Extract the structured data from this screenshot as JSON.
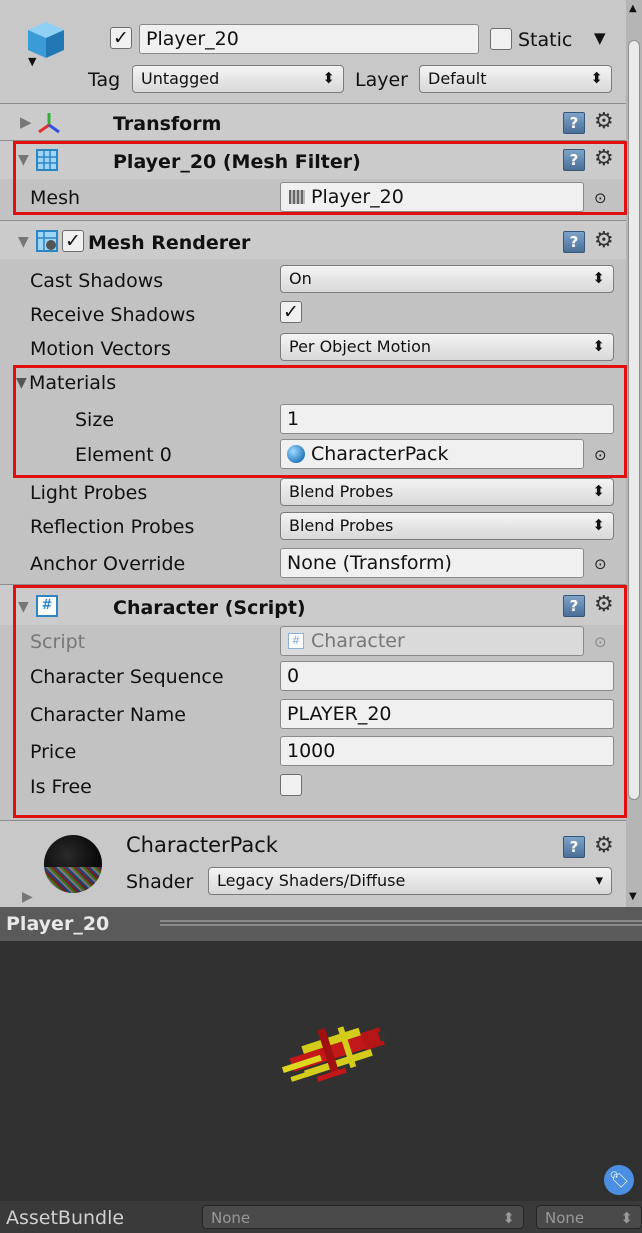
{
  "header": {
    "name": "Player_20",
    "static_label": "Static",
    "tag_label": "Tag",
    "tag_value": "Untagged",
    "layer_label": "Layer",
    "layer_value": "Default"
  },
  "transform": {
    "title": "Transform"
  },
  "mesh_filter": {
    "title": "Player_20 (Mesh Filter)",
    "mesh_label": "Mesh",
    "mesh_value": "Player_20"
  },
  "mesh_renderer": {
    "title": "Mesh Renderer",
    "cast_shadows_label": "Cast Shadows",
    "cast_shadows_value": "On",
    "receive_shadows_label": "Receive Shadows",
    "motion_vectors_label": "Motion Vectors",
    "motion_vectors_value": "Per Object Motion",
    "materials_label": "Materials",
    "size_label": "Size",
    "size_value": "1",
    "element0_label": "Element 0",
    "element0_value": "CharacterPack",
    "light_probes_label": "Light Probes",
    "light_probes_value": "Blend Probes",
    "reflection_probes_label": "Reflection Probes",
    "reflection_probes_value": "Blend Probes",
    "anchor_override_label": "Anchor Override",
    "anchor_override_value": "None (Transform)"
  },
  "character_script": {
    "title": "Character (Script)",
    "script_label": "Script",
    "script_value": "Character",
    "sequence_label": "Character Sequence",
    "sequence_value": "0",
    "name_label": "Character Name",
    "name_value": "PLAYER_20",
    "price_label": "Price",
    "price_value": "1000",
    "is_free_label": "Is Free"
  },
  "material": {
    "name": "CharacterPack",
    "shader_label": "Shader",
    "shader_value": "Legacy Shaders/Diffuse"
  },
  "preview": {
    "title": "Player_20"
  },
  "assetbundle": {
    "label": "AssetBundle",
    "name_value": "None",
    "variant_value": "None"
  },
  "colors": {
    "highlight_box": "#e01010",
    "preview_bg": "#313131",
    "panel_bg": "#c2c2c2"
  }
}
